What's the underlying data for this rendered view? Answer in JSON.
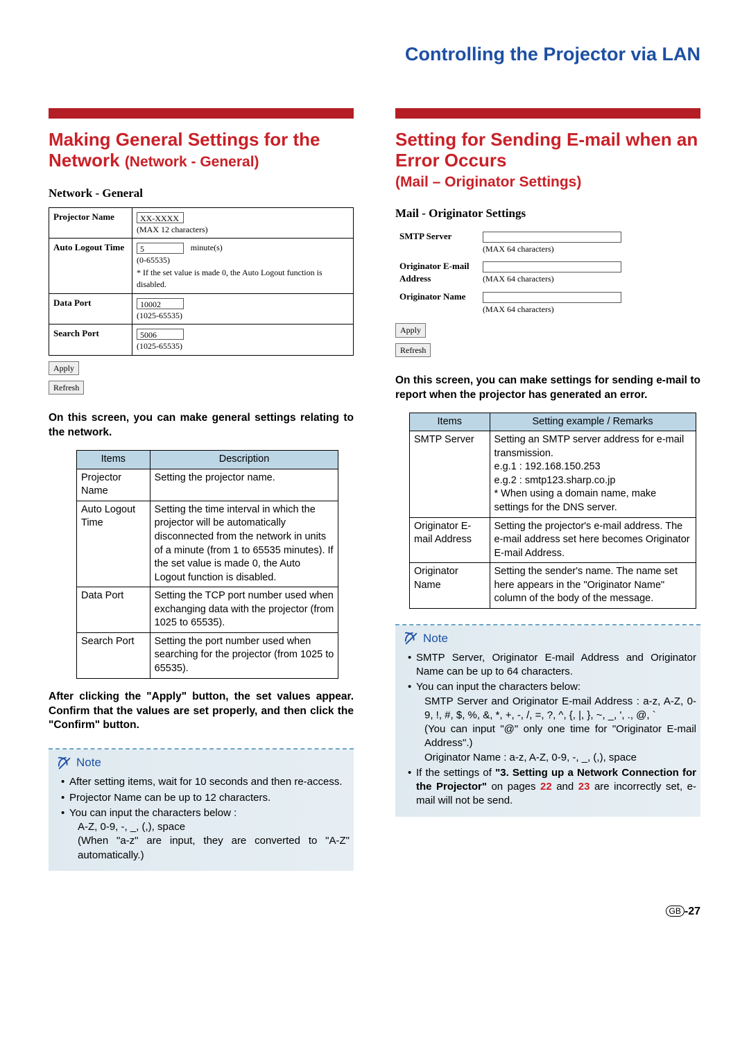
{
  "page_title": "Controlling the Projector via LAN",
  "left": {
    "heading_main": "Making General Settings for the Network ",
    "heading_sub": "(Network - General)",
    "form_title": "Network - General",
    "rows": {
      "projector_name": {
        "label": "Projector Name",
        "value": "XX-XXXX",
        "hint": "(MAX 12 characters)"
      },
      "auto_logout": {
        "label": "Auto Logout Time",
        "value": "5",
        "unit": "minute(s)",
        "range": "(0-65535)",
        "note": "* If the set value is made 0, the Auto Logout function is disabled."
      },
      "data_port": {
        "label": "Data Port",
        "value": "10002",
        "range": "(1025-65535)"
      },
      "search_port": {
        "label": "Search Port",
        "value": "5006",
        "range": "(1025-65535)"
      }
    },
    "apply": "Apply",
    "refresh": "Refresh",
    "intro": "On this screen, you can make general settings relating to the network.",
    "table_head_items": "Items",
    "table_head_desc": "Description",
    "table": [
      {
        "item": "Projector Name",
        "desc": "Setting the projector name."
      },
      {
        "item": "Auto Logout Time",
        "desc": "Setting the time interval in which the projector will be automatically disconnected from the network in units of a minute (from 1 to 65535 minutes). If the set value is made 0, the Auto Logout function is disabled."
      },
      {
        "item": "Data Port",
        "desc": "Setting the TCP port number used when exchanging data with the projector (from 1025 to 65535)."
      },
      {
        "item": "Search Port",
        "desc": "Setting the port number used when searching for the projector (from 1025 to 65535)."
      }
    ],
    "after": "After clicking the \"Apply\" button, the set values appear. Confirm that the values are set properly, and then click the \"Confirm\" button.",
    "note_label": "Note",
    "notes": [
      "After setting items, wait for 10 seconds and then re-access.",
      "Projector Name can be up to 12 characters.",
      "You can input the characters below :"
    ],
    "note_sub1": "A-Z, 0-9, -, _, (,), space",
    "note_sub2": "(When \"a-z\" are input, they are converted to \"A-Z\" automatically.)"
  },
  "right": {
    "heading_main": "Setting for Sending E-mail when an Error Occurs",
    "heading_sub": "(Mail – Originator Settings)",
    "form_title": "Mail - Originator Settings",
    "rows": {
      "smtp": {
        "label": "SMTP Server",
        "hint": "(MAX 64 characters)"
      },
      "email": {
        "label": "Originator E-mail Address",
        "hint": "(MAX 64 characters)"
      },
      "name": {
        "label": "Originator Name",
        "hint": "(MAX 64 characters)"
      }
    },
    "apply": "Apply",
    "refresh": "Refresh",
    "intro": "On this screen, you can make settings for sending e-mail to report when the projector has generated an error.",
    "table_head_items": "Items",
    "table_head_desc": "Setting example / Remarks",
    "table": [
      {
        "item": "SMTP Server",
        "desc": "Setting an SMTP server address for e-mail transmission.\ne.g.1 : 192.168.150.253\ne.g.2 : smtp123.sharp.co.jp\n*  When using a domain name, make settings for the DNS server."
      },
      {
        "item": "Originator E-mail Address",
        "desc": "Setting the projector's e-mail address. The e-mail address set here becomes Originator E-mail Address."
      },
      {
        "item": "Originator Name",
        "desc": "Setting the sender's name. The name set here appears in the \"Originator Name\" column of the body of the message."
      }
    ],
    "note_label": "Note",
    "notes": {
      "n1": "SMTP Server, Originator E-mail Address and Originator Name can be up to 64 characters.",
      "n2": "You can input the characters below:",
      "n2a": "SMTP Server and Originator E-mail Address : a-z, A-Z, 0-9, !, #, $, %, &, *, +, -, /, =, ?, ^, {, |, }, ~, _, ', ., @, `",
      "n2b": "(You can input \"@\" only one time for \"Originator E-mail Address\".)",
      "n2c": "Originator Name : a-z, A-Z, 0-9, -, _, (,), space",
      "n3a": "If the settings of ",
      "n3bold": "\"3. Setting up a Network Connection for the Projector\"",
      "n3b": " on pages ",
      "n3p1": "22",
      "n3c": " and ",
      "n3p2": "23",
      "n3d": " are incorrectly set, e-mail will not be send."
    }
  },
  "footer": {
    "gb": "GB",
    "page": "-27"
  }
}
